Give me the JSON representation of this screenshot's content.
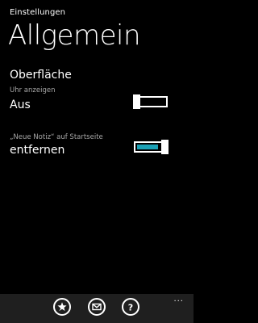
{
  "header": {
    "app_title": "Einstellungen",
    "page_title": "Allgemein"
  },
  "section": {
    "heading": "Oberfläche"
  },
  "settings": [
    {
      "label": "Uhr anzeigen",
      "value": "Aus",
      "toggle_on": false
    },
    {
      "label": "„Neue Notiz“ auf Startseite",
      "value": "entfernen",
      "toggle_on": true
    }
  ],
  "colors": {
    "background": "#000000",
    "accent": "#1ba1b6",
    "appbar": "#1f1f1f"
  },
  "appbar": {
    "buttons": [
      {
        "icon": "rate-star-icon"
      },
      {
        "icon": "mail-icon"
      },
      {
        "icon": "help-icon"
      }
    ],
    "more": "..."
  }
}
